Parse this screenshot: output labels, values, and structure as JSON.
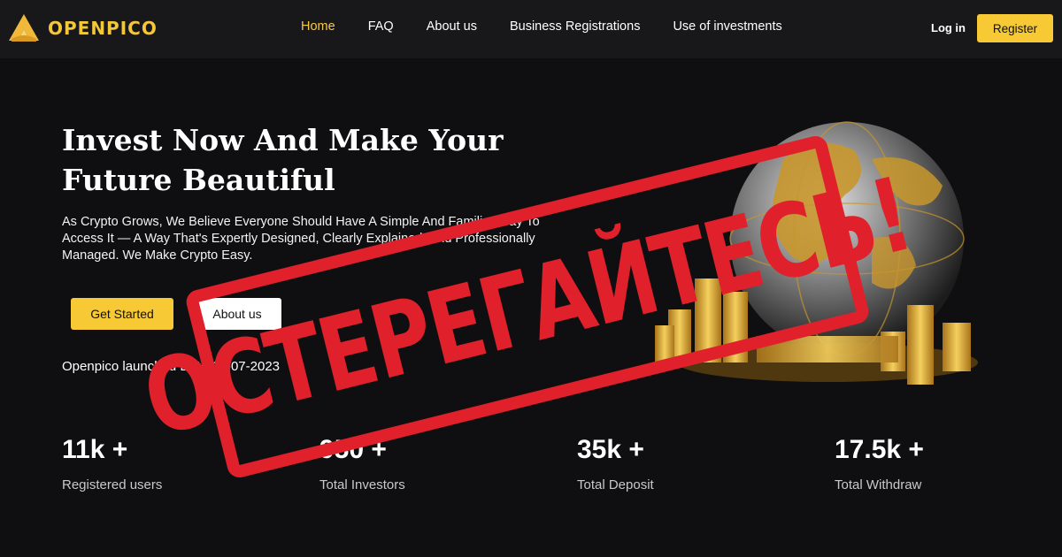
{
  "header": {
    "brand": "OPENPICO",
    "nav": [
      "Home",
      "FAQ",
      "About us",
      "Business Registrations",
      "Use of investments"
    ],
    "active_nav": "Home",
    "login": "Log in",
    "register": "Register"
  },
  "hero": {
    "title": "Invest Now And Make Your Future Beautiful",
    "description": "As Crypto Grows, We Believe Everyone Should Have A Simple And Familiar Way To Access It — A Way That's Expertly Designed, Clearly Explained, And Professionally Managed. We Make Crypto Easy.",
    "get_started": "Get Started",
    "about_us": "About us",
    "launched": "Openpico launched Date 17-07-2023"
  },
  "stats": [
    {
      "value": "11k +",
      "label": "Registered users"
    },
    {
      "value": "950 +",
      "label": "Total Investors"
    },
    {
      "value": "35k +",
      "label": "Total Deposit"
    },
    {
      "value": "17.5k +",
      "label": "Total Withdraw"
    }
  ],
  "stamp": {
    "text": "ОСТЕРЕГАЙТЕСЬ!",
    "color": "#e0202a"
  },
  "colors": {
    "accent": "#f7c935",
    "background": "#0f0f11",
    "header": "#18181b"
  },
  "icons": {
    "logo": "gold-triangle-logo-icon",
    "illustration": "gold-globe-coins-image"
  }
}
